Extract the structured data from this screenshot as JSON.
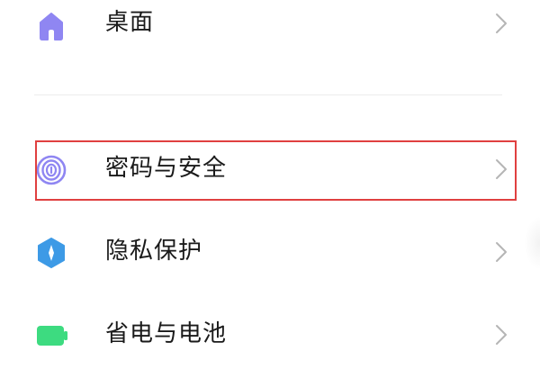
{
  "settings_list": {
    "items": [
      {
        "label": "桌面",
        "icon": "home-icon",
        "icon_color": "#8f86f2"
      },
      {
        "label": "密码与安全",
        "icon": "fingerprint-icon",
        "icon_color": "#8f86f2",
        "highlighted": true
      },
      {
        "label": "隐私保护",
        "icon": "privacy-shield-icon",
        "icon_color": "#3d9ae6"
      },
      {
        "label": "省电与电池",
        "icon": "battery-icon",
        "icon_color": "#3ddb80"
      }
    ]
  },
  "colors": {
    "highlight_border": "#e04040",
    "chevron": "#b5b5b5",
    "text": "#1a1a1a"
  }
}
